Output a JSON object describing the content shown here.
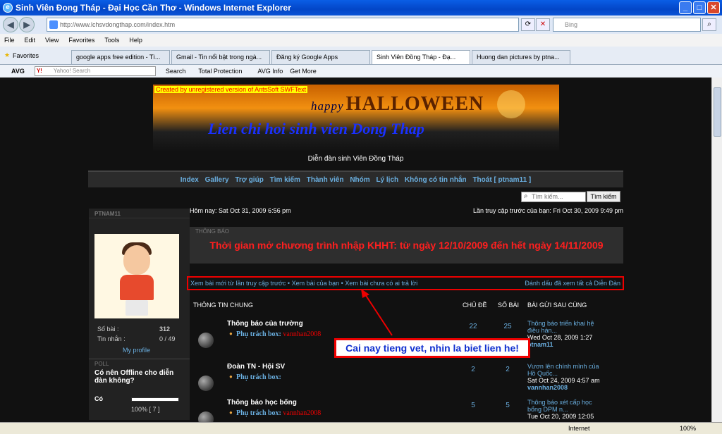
{
  "window": {
    "title": "Sinh Viên Đong Tháp - Đại Học Cần Thơ - Windows Internet Explorer"
  },
  "address": {
    "url": "http://www.lchsvdongthap.com/index.htm",
    "search_placeholder": "Bing"
  },
  "menu": [
    "File",
    "Edit",
    "View",
    "Favorites",
    "Tools",
    "Help"
  ],
  "favorites_label": "Favorites",
  "tabs": [
    "google apps free edition - Tì...",
    "Gmail - Tin nổi bật trong ngà...",
    "Đăng ký Google Apps",
    "Sinh Viên Đồng Tháp - Đạ...",
    "Huong dan pictures by ptna..."
  ],
  "toolbar2": {
    "avg": "AVG",
    "yahoo_placeholder": "Yahoo! Search",
    "search": "Search",
    "total_protection": "Total Protection",
    "avg_info": "AVG Info",
    "get_more": "Get More"
  },
  "banner": {
    "swf": "Created by unregistered version of AntsSoft SWFText",
    "happy": "happy",
    "halloween": "HALLOWEEN",
    "lien": "Lien chi hoi sinh vien Dong Thap"
  },
  "forum_name": "Diễn đàn sinh Viên Đồng Tháp",
  "nav": [
    "Index",
    "Gallery",
    "Trợ giúp",
    "Tìm kiếm",
    "Thành viên",
    "Nhóm",
    "Lý lịch",
    "Không có tin nhắn",
    "Thoát [ ptnam11 ]"
  ],
  "search": {
    "placeholder": "Tìm kiếm...",
    "button": "Tìm kiếm"
  },
  "user": {
    "name": "PTNAM11",
    "posts_label": "Số bài :",
    "posts": "312",
    "msgs_label": "Tin nhắn :",
    "msgs": "0 / 49",
    "profile": "My profile"
  },
  "poll": {
    "label": "POLL",
    "question": "Có nên Offline cho diễn đàn không?",
    "option": "Có",
    "pct": "100% [ 7 ]"
  },
  "main": {
    "today": "Hôm nay: Sat Oct 31, 2009 6:56 pm",
    "last_visit": "Lần truy cập trước của bạn: Fri Oct 30, 2009 9:49 pm",
    "notice_label": "THÔNG BÁO",
    "notice": "Thời gian mở chương trình nhập KHHT: từ ngày 12/10/2009 đến hết ngày 14/11/2009"
  },
  "links": {
    "new": "Xem bài mới từ lần truy cập trước",
    "mine": "Xem bài của bạn",
    "unanswered": "Xem bài chưa có ai trả lời",
    "mark": "Đánh dấu đã xem tất cả Diễn Đàn",
    "sep": "•"
  },
  "headers": {
    "general": "THÔNG TIN CHUNG",
    "topics": "CHỦ ĐỀ",
    "posts": "SỐ BÀI",
    "last": "BÀI GỬI SAU CÙNG"
  },
  "forums": [
    {
      "title": "Thông báo của trường",
      "mod_label": "Phụ trách box:",
      "mod": "vannhan2008",
      "topics": "22",
      "posts": "25",
      "last1": "Thông báo triển khai hệ",
      "last2": "điều hàn...",
      "date": "Wed Oct 28, 2009 1:27",
      "user": "ptnam11"
    },
    {
      "title": "Đoàn TN - Hội SV",
      "mod_label": "Phụ trách box:",
      "mod": "",
      "topics": "2",
      "posts": "2",
      "last1": "Vươn lên chính mình của",
      "last2": "Hồ Quốc...",
      "date": "Sat Oct 24, 2009 4:57 am",
      "user": "vannhan2008"
    },
    {
      "title": "Thông báo học bổng",
      "mod_label": "Phụ trách box:",
      "mod": "vannhan2008",
      "topics": "5",
      "posts": "5",
      "last1": "Thông báo xét cấp học",
      "last2": "bổng DPM n...",
      "date": "Tue Oct 20, 2009 12:05",
      "user": ""
    }
  ],
  "callout": "Cai nay tieng vet, nhin la biet lien he!",
  "status": {
    "zone": "Internet",
    "zoom": "100%"
  }
}
